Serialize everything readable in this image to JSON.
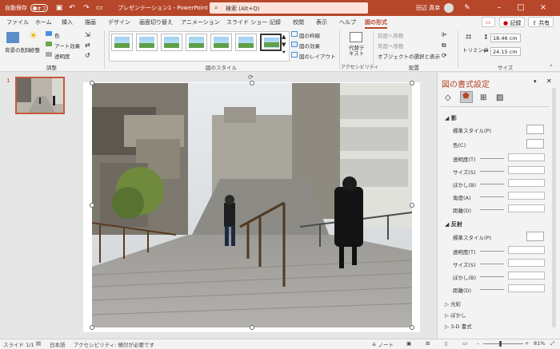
{
  "titlebar": {
    "autosave_label": "自動保存",
    "autosave_state": "オフ",
    "doc_title": "プレゼンテーション1 - PowerPoint",
    "search_placeholder": "検索 (Alt+Q)",
    "user_name": "田辺 真幸"
  },
  "tabs": [
    "ファイル",
    "ホーム",
    "挿入",
    "描画",
    "デザイン",
    "画面切り替え",
    "アニメーション",
    "スライド ショー",
    "記録",
    "校閲",
    "表示",
    "ヘルプ",
    "図の形式"
  ],
  "active_tab": "図の形式",
  "ribbon_buttons": {
    "record": "記録",
    "share": "共有"
  },
  "ribbon": {
    "remove_bg": "背景の削除",
    "corrections": "修整",
    "color": "色",
    "artistic": "アート効果",
    "transparency": "透明度",
    "adjust_group": "調整",
    "styles_group": "図のスタイル",
    "border": "図の枠線",
    "effects": "図の効果",
    "layout": "図のレイアウト",
    "alt_text": "代替テキスト",
    "accessibility_group": "アクセシビリティ",
    "bring_forward": "前面へ移動",
    "send_backward": "背面へ移動",
    "selection_pane": "オブジェクトの選択と表示",
    "arrange_group": "配置",
    "crop": "トリミング",
    "height": "18.46 cm",
    "width": "24.15 cm",
    "size_group": "サイズ"
  },
  "slide_number": "1",
  "panel": {
    "title": "図の書式設定",
    "shadow_section": "影",
    "shadow_fields": [
      "標準スタイル(P)",
      "色(C)",
      "透明度(T)",
      "サイズ(S)",
      "ぼかし(B)",
      "角度(A)",
      "距離(D)"
    ],
    "reflection_section": "反射",
    "reflection_fields": [
      "標準スタイル(P)",
      "透明度(T)",
      "サイズ(S)",
      "ぼかし(B)",
      "距離(D)"
    ],
    "collapsed": [
      "光彩",
      "ぼかし",
      "3-D 書式"
    ]
  },
  "status": {
    "slide_info": "スライド 1/1",
    "language": "日本語",
    "accessibility": "アクセシビリティ: 検討が必要です",
    "notes": "ノート",
    "zoom": "81%"
  },
  "colors": {
    "accent": "#b7472a"
  }
}
